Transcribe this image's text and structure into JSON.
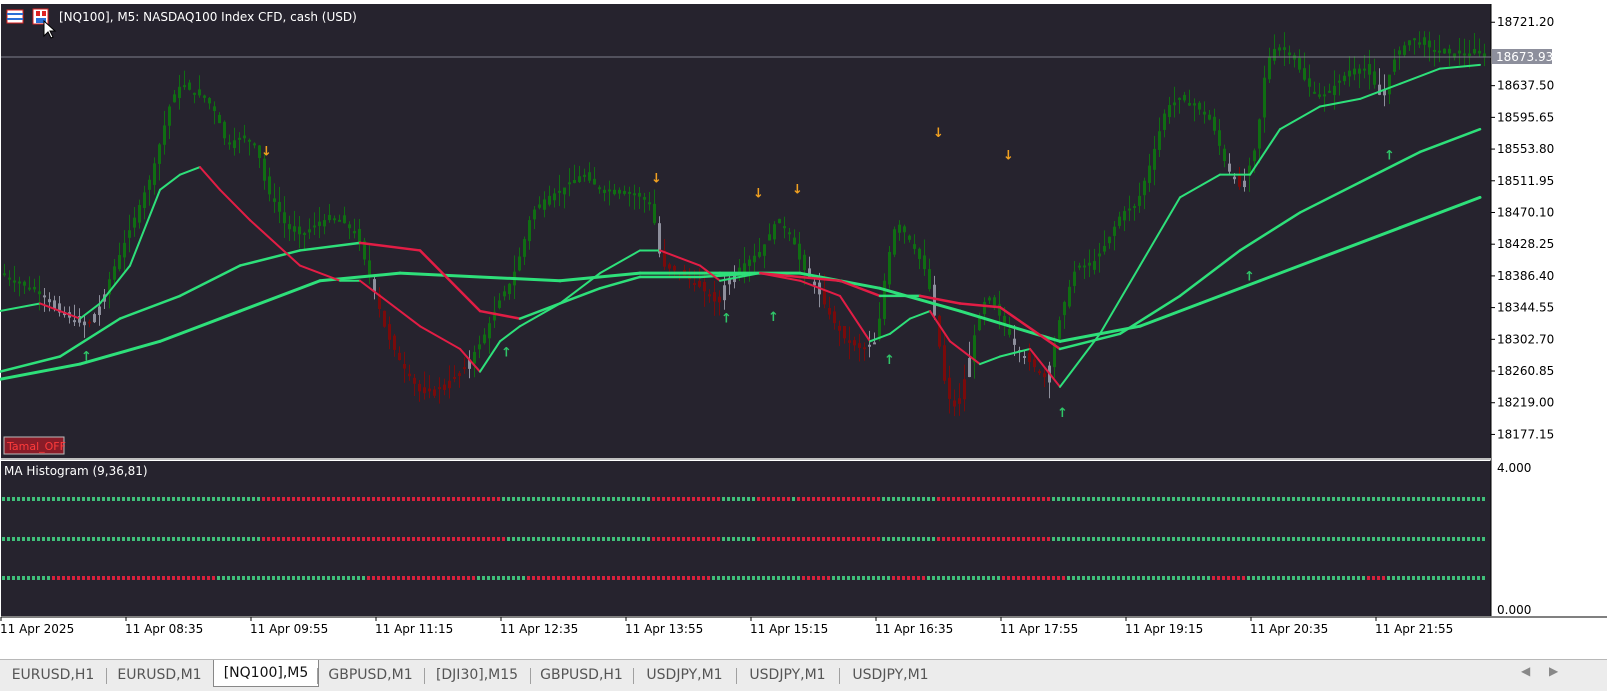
{
  "window": {
    "title": "[NQ100], M5:  NASDAQ100 Index CFD, cash (USD)",
    "account_badge": "Tamal_OFF"
  },
  "colors": {
    "background": "#26232e",
    "bull": "#0f6e12",
    "bear": "#7a0a0a",
    "neutral": "#8d8f9c",
    "red_line": "#e21d45",
    "green_line": "#2ee07a",
    "green_dots": "#3fbf7a",
    "red_dots": "#d8203c",
    "arrow_up": "#2fc468",
    "arrow_down": "#f0a020"
  },
  "price_axis": {
    "labels": [
      "18721.20",
      "18637.50",
      "18595.65",
      "18553.80",
      "18511.95",
      "18470.10",
      "18428.25",
      "18386.40",
      "18344.55",
      "18302.70",
      "18260.85",
      "18219.00",
      "18177.15"
    ],
    "current_price": "18673.93"
  },
  "indicator": {
    "title": "MA Histogram (9,36,81)",
    "scale_max": "4.000",
    "scale_min": "0.000",
    "rows": [
      {
        "level": 3,
        "red_segments": [
          [
            0.175,
            0.335
          ],
          [
            0.437,
            0.483
          ],
          [
            0.507,
            0.53
          ],
          [
            0.533,
            0.592
          ],
          [
            0.627,
            0.707
          ]
        ]
      },
      {
        "level": 2,
        "red_segments": [
          [
            0.175,
            0.337
          ],
          [
            0.437,
            0.483
          ],
          [
            0.507,
            0.592
          ],
          [
            0.627,
            0.707
          ]
        ]
      },
      {
        "level": 1,
        "red_segments": [
          [
            0.033,
            0.142
          ],
          [
            0.243,
            0.32
          ],
          [
            0.353,
            0.478
          ],
          [
            0.537,
            0.557
          ],
          [
            0.597,
            0.622
          ],
          [
            0.672,
            0.717
          ],
          [
            0.813,
            0.838
          ],
          [
            0.918,
            0.933
          ]
        ]
      }
    ]
  },
  "time_axis": {
    "labels": [
      "11 Apr 2025",
      "11 Apr 08:35",
      "11 Apr 09:55",
      "11 Apr 11:15",
      "11 Apr 12:35",
      "11 Apr 13:55",
      "11 Apr 15:15",
      "11 Apr 16:35",
      "11 Apr 17:55",
      "11 Apr 19:15",
      "11 Apr 20:35",
      "11 Apr 21:55"
    ]
  },
  "tabs": [
    {
      "label": "EURUSD,H1",
      "active": false
    },
    {
      "label": "EURUSD,M1",
      "active": false
    },
    {
      "label": "[NQ100],M5",
      "active": true
    },
    {
      "label": "GBPUSD,M1",
      "active": false
    },
    {
      "label": "[DJI30],M15",
      "active": false
    },
    {
      "label": "GBPUSD,H1",
      "active": false
    },
    {
      "label": "USDJPY,M1",
      "active": false
    },
    {
      "label": "USDJPY,M1",
      "active": false
    },
    {
      "label": "USDJPY,M1",
      "active": false
    }
  ],
  "chart_data": {
    "type": "candlestick",
    "symbol": "[NQ100]",
    "timeframe": "M5",
    "ylim": [
      18150,
      18740
    ],
    "close_path": [
      [
        0,
        18390
      ],
      [
        20,
        18375
      ],
      [
        40,
        18365
      ],
      [
        55,
        18340
      ],
      [
        70,
        18330
      ],
      [
        85,
        18320
      ],
      [
        100,
        18350
      ],
      [
        110,
        18390
      ],
      [
        120,
        18420
      ],
      [
        135,
        18470
      ],
      [
        150,
        18520
      ],
      [
        160,
        18570
      ],
      [
        170,
        18620
      ],
      [
        180,
        18640
      ],
      [
        190,
        18630
      ],
      [
        205,
        18620
      ],
      [
        215,
        18600
      ],
      [
        225,
        18560
      ],
      [
        240,
        18570
      ],
      [
        255,
        18560
      ],
      [
        265,
        18500
      ],
      [
        275,
        18480
      ],
      [
        285,
        18450
      ],
      [
        300,
        18440
      ],
      [
        320,
        18460
      ],
      [
        340,
        18460
      ],
      [
        355,
        18440
      ],
      [
        370,
        18380
      ],
      [
        385,
        18310
      ],
      [
        400,
        18270
      ],
      [
        420,
        18230
      ],
      [
        440,
        18240
      ],
      [
        460,
        18260
      ],
      [
        470,
        18280
      ],
      [
        480,
        18300
      ],
      [
        490,
        18330
      ],
      [
        500,
        18360
      ],
      [
        510,
        18380
      ],
      [
        520,
        18420
      ],
      [
        530,
        18470
      ],
      [
        545,
        18490
      ],
      [
        560,
        18500
      ],
      [
        580,
        18520
      ],
      [
        600,
        18500
      ],
      [
        620,
        18500
      ],
      [
        640,
        18490
      ],
      [
        650,
        18480
      ],
      [
        660,
        18400
      ],
      [
        680,
        18390
      ],
      [
        700,
        18370
      ],
      [
        715,
        18350
      ],
      [
        725,
        18380
      ],
      [
        740,
        18400
      ],
      [
        760,
        18420
      ],
      [
        775,
        18460
      ],
      [
        790,
        18440
      ],
      [
        800,
        18400
      ],
      [
        815,
        18370
      ],
      [
        830,
        18330
      ],
      [
        845,
        18300
      ],
      [
        860,
        18290
      ],
      [
        875,
        18300
      ],
      [
        885,
        18400
      ],
      [
        895,
        18460
      ],
      [
        910,
        18430
      ],
      [
        925,
        18390
      ],
      [
        935,
        18320
      ],
      [
        945,
        18230
      ],
      [
        955,
        18210
      ],
      [
        965,
        18260
      ],
      [
        975,
        18320
      ],
      [
        985,
        18360
      ],
      [
        1000,
        18330
      ],
      [
        1015,
        18290
      ],
      [
        1030,
        18270
      ],
      [
        1045,
        18250
      ],
      [
        1060,
        18340
      ],
      [
        1075,
        18400
      ],
      [
        1090,
        18400
      ],
      [
        1105,
        18430
      ],
      [
        1120,
        18470
      ],
      [
        1135,
        18480
      ],
      [
        1150,
        18540
      ],
      [
        1165,
        18610
      ],
      [
        1180,
        18620
      ],
      [
        1195,
        18610
      ],
      [
        1210,
        18590
      ],
      [
        1225,
        18530
      ],
      [
        1240,
        18500
      ],
      [
        1255,
        18560
      ],
      [
        1265,
        18670
      ],
      [
        1275,
        18690
      ],
      [
        1290,
        18680
      ],
      [
        1305,
        18640
      ],
      [
        1320,
        18620
      ],
      [
        1335,
        18640
      ],
      [
        1350,
        18660
      ],
      [
        1365,
        18660
      ],
      [
        1380,
        18620
      ],
      [
        1395,
        18680
      ],
      [
        1410,
        18700
      ],
      [
        1425,
        18690
      ],
      [
        1440,
        18680
      ],
      [
        1460,
        18680
      ],
      [
        1480,
        18680
      ]
    ],
    "ma9": [
      [
        0,
        18340
      ],
      [
        40,
        18350
      ],
      [
        80,
        18330
      ],
      [
        100,
        18350
      ],
      [
        130,
        18400
      ],
      [
        160,
        18500
      ],
      [
        180,
        18520
      ],
      [
        200,
        18530
      ],
      [
        220,
        18500
      ],
      [
        250,
        18460
      ],
      [
        300,
        18400
      ],
      [
        340,
        18380
      ],
      [
        360,
        18380
      ],
      [
        380,
        18360
      ],
      [
        420,
        18320
      ],
      [
        460,
        18290
      ],
      [
        480,
        18260
      ],
      [
        500,
        18300
      ],
      [
        520,
        18320
      ],
      [
        560,
        18350
      ],
      [
        600,
        18390
      ],
      [
        640,
        18420
      ],
      [
        660,
        18420
      ],
      [
        700,
        18400
      ],
      [
        720,
        18380
      ],
      [
        760,
        18390
      ],
      [
        800,
        18380
      ],
      [
        840,
        18360
      ],
      [
        870,
        18300
      ],
      [
        890,
        18310
      ],
      [
        910,
        18330
      ],
      [
        930,
        18340
      ],
      [
        950,
        18300
      ],
      [
        980,
        18270
      ],
      [
        1000,
        18280
      ],
      [
        1030,
        18290
      ],
      [
        1060,
        18240
      ],
      [
        1100,
        18310
      ],
      [
        1140,
        18400
      ],
      [
        1180,
        18490
      ],
      [
        1220,
        18520
      ],
      [
        1250,
        18520
      ],
      [
        1280,
        18580
      ],
      [
        1320,
        18610
      ],
      [
        1360,
        18620
      ],
      [
        1400,
        18640
      ],
      [
        1440,
        18660
      ],
      [
        1480,
        18665
      ]
    ],
    "ma36": [
      [
        0,
        18260
      ],
      [
        60,
        18280
      ],
      [
        120,
        18330
      ],
      [
        180,
        18360
      ],
      [
        240,
        18400
      ],
      [
        300,
        18420
      ],
      [
        360,
        18430
      ],
      [
        420,
        18420
      ],
      [
        480,
        18340
      ],
      [
        520,
        18330
      ],
      [
        560,
        18350
      ],
      [
        600,
        18370
      ],
      [
        640,
        18385
      ],
      [
        700,
        18385
      ],
      [
        760,
        18390
      ],
      [
        800,
        18385
      ],
      [
        840,
        18380
      ],
      [
        880,
        18360
      ],
      [
        920,
        18360
      ],
      [
        960,
        18350
      ],
      [
        1000,
        18345
      ],
      [
        1060,
        18290
      ],
      [
        1120,
        18310
      ],
      [
        1180,
        18360
      ],
      [
        1240,
        18420
      ],
      [
        1300,
        18470
      ],
      [
        1360,
        18510
      ],
      [
        1420,
        18550
      ],
      [
        1480,
        18580
      ]
    ],
    "ma81": [
      [
        0,
        18250
      ],
      [
        80,
        18270
      ],
      [
        160,
        18300
      ],
      [
        240,
        18340
      ],
      [
        320,
        18380
      ],
      [
        400,
        18390
      ],
      [
        480,
        18385
      ],
      [
        560,
        18380
      ],
      [
        640,
        18390
      ],
      [
        720,
        18390
      ],
      [
        800,
        18390
      ],
      [
        880,
        18370
      ],
      [
        960,
        18340
      ],
      [
        1060,
        18300
      ],
      [
        1140,
        18320
      ],
      [
        1200,
        18350
      ],
      [
        1260,
        18380
      ],
      [
        1320,
        18410
      ],
      [
        1400,
        18450
      ],
      [
        1480,
        18490
      ]
    ],
    "signal_arrows_up": [
      [
        85,
        18275
      ],
      [
        505,
        18280
      ],
      [
        725,
        18325
      ],
      [
        772,
        18327
      ],
      [
        888,
        18270
      ],
      [
        1061,
        18200
      ],
      [
        1248,
        18380
      ],
      [
        1388,
        18540
      ]
    ],
    "signal_arrows_down": [
      [
        265,
        18545
      ],
      [
        655,
        18510
      ],
      [
        757,
        18490
      ],
      [
        796,
        18495
      ],
      [
        937,
        18570
      ],
      [
        1007,
        18540
      ]
    ]
  }
}
